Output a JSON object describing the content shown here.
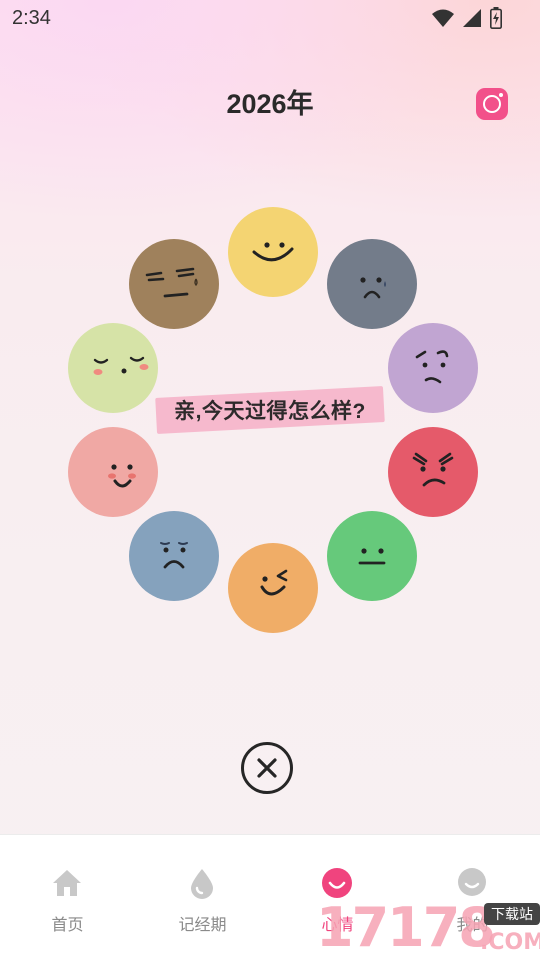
{
  "status": {
    "time": "2:34",
    "icons": [
      "wifi-icon",
      "cell-signal-icon",
      "battery-charging-icon"
    ]
  },
  "header": {
    "title": "2026年",
    "camera_icon": "camera-icon",
    "accent": "#f2508a"
  },
  "prompt": {
    "text": "亲,今天过得怎么样?"
  },
  "moods": [
    {
      "name": "happy",
      "color": "#f4d472"
    },
    {
      "name": "worried",
      "color": "#737c8a"
    },
    {
      "name": "confused",
      "color": "#c1a5d2"
    },
    {
      "name": "angry",
      "color": "#e55a6a"
    },
    {
      "name": "neutral",
      "color": "#66c97b"
    },
    {
      "name": "wink",
      "color": "#f0ad67"
    },
    {
      "name": "sad",
      "color": "#85a2bd"
    },
    {
      "name": "shy",
      "color": "#f0a8a4"
    },
    {
      "name": "content",
      "color": "#d6e3a7"
    },
    {
      "name": "smug",
      "color": "#9f815c"
    }
  ],
  "close": {
    "icon": "close-icon"
  },
  "nav": [
    {
      "label": "首页",
      "icon": "home-icon",
      "active": false
    },
    {
      "label": "记经期",
      "icon": "drop-icon",
      "active": false
    },
    {
      "label": "心情",
      "icon": "mood-icon",
      "active": true
    },
    {
      "label": "我的",
      "icon": "profile-icon",
      "active": false
    }
  ],
  "watermark": {
    "number": "17178",
    "suffix": ".COM",
    "tag": "下载站"
  }
}
